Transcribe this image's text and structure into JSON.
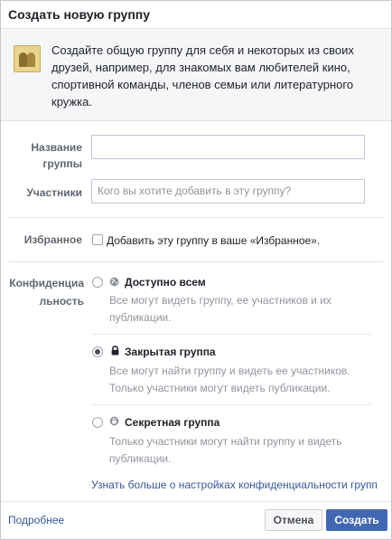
{
  "dialog": {
    "title": "Создать новую группу",
    "intro_text": "Создайте общую группу для себя и некоторых из своих друзей, например, для знакомых вам любителей кино, спортивной команды, членов семьи или литературного кружка."
  },
  "form": {
    "name_label": "Название группы",
    "name_value": "",
    "members_label": "Участники",
    "members_placeholder": "Кого вы хотите добавить в эту группу?",
    "favorites_label": "Избранное",
    "favorites_checkbox_label": "Добавить эту группу в ваше «Избранное».",
    "favorites_checked": false,
    "privacy_label": "Конфиденциальность",
    "privacy_options": [
      {
        "icon": "globe-icon",
        "title": "Доступно всем",
        "description": "Все могут видеть группу, ее участников и их публикации.",
        "selected": false
      },
      {
        "icon": "lock-icon",
        "title": "Закрытая группа",
        "description": "Все могут найти группу и видеть ее участников. Только участники могут видеть публикации.",
        "selected": true
      },
      {
        "icon": "secret-icon",
        "title": "Секретная группа",
        "description": "Только участники могут найти группу и видеть публикации.",
        "selected": false
      }
    ],
    "learn_more_link": "Узнать больше о настройках конфиденциальности групп"
  },
  "footer": {
    "more_link": "Подробнее",
    "cancel_label": "Отмена",
    "create_label": "Создать"
  },
  "colors": {
    "link": "#365899",
    "primary_button": "#4267b2"
  }
}
